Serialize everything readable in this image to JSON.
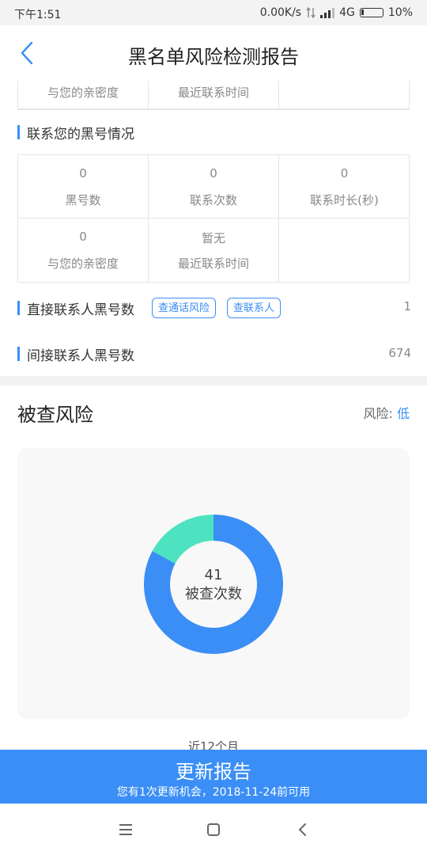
{
  "status": {
    "time": "下午1:51",
    "speed": "0.00K/s",
    "network": "4G",
    "battery": "10%"
  },
  "nav": {
    "title": "黑名单风险检测报告"
  },
  "top_partial": {
    "labels": [
      "与您的亲密度",
      "最近联系时间",
      ""
    ]
  },
  "blacklist_section": {
    "title": "联系您的黑号情况",
    "cells": [
      {
        "value": "0",
        "label": "黑号数"
      },
      {
        "value": "0",
        "label": "联系次数"
      },
      {
        "value": "0",
        "label": "联系时长(秒)"
      },
      {
        "value": "0",
        "label": "与您的亲密度"
      },
      {
        "value": "暂无",
        "label": "最近联系时间"
      },
      {
        "value": "",
        "label": ""
      }
    ]
  },
  "direct": {
    "title": "直接联系人黑号数",
    "tag1": "查通话风险",
    "tag2": "查联系人",
    "count": "1"
  },
  "indirect": {
    "title": "间接联系人黑号数",
    "count": "674"
  },
  "risk": {
    "title": "被查风险",
    "level_label": "风险:",
    "level_value": "低"
  },
  "chart_data": {
    "type": "pie",
    "values": [
      34,
      7
    ],
    "colors": [
      "#3a8ef6",
      "#4de3c1"
    ],
    "center_value": "41",
    "center_label": "被查次数"
  },
  "period": "近12个月",
  "update": {
    "title": "更新报告",
    "subtitle": "您有1次更新机会，2018-11-24前可用"
  }
}
